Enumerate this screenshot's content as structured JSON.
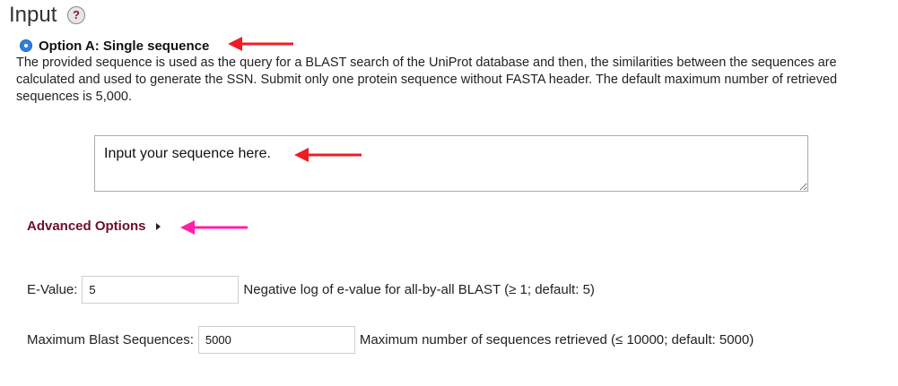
{
  "section": {
    "title": "Input",
    "help_glyph": "?"
  },
  "option_a": {
    "label": "Option A: Single sequence",
    "selected": true,
    "description": "The provided sequence is used as the query for a BLAST search of the UniProt database and then, the similarities between the sequences are calculated and used to generate the SSN. Submit only one protein sequence without FASTA header. The default maximum number of retrieved sequences is 5,000."
  },
  "sequence_input": {
    "placeholder": "Input your sequence here.",
    "value": ""
  },
  "advanced": {
    "label": "Advanced Options",
    "expanded": true
  },
  "evalue": {
    "label": "E-Value:",
    "value": "5",
    "hint": "Negative log of e-value for all-by-all BLAST (≥ 1; default: 5)"
  },
  "max_blast": {
    "label": "Maximum Blast Sequences:",
    "value": "5000",
    "hint": "Maximum number of sequences retrieved (≤ 10000; default: 5000)"
  },
  "colors": {
    "annotation_red": "#ee1c25",
    "annotation_magenta": "#ff1fa8",
    "advanced_link": "#6b0f2b",
    "radio_blue": "#2f7fe0"
  },
  "icons": {
    "help": "question-circle-icon",
    "radio": "radio-selected-icon",
    "caret": "caret-right-icon",
    "annotation_arrow": "left-arrow-icon"
  }
}
